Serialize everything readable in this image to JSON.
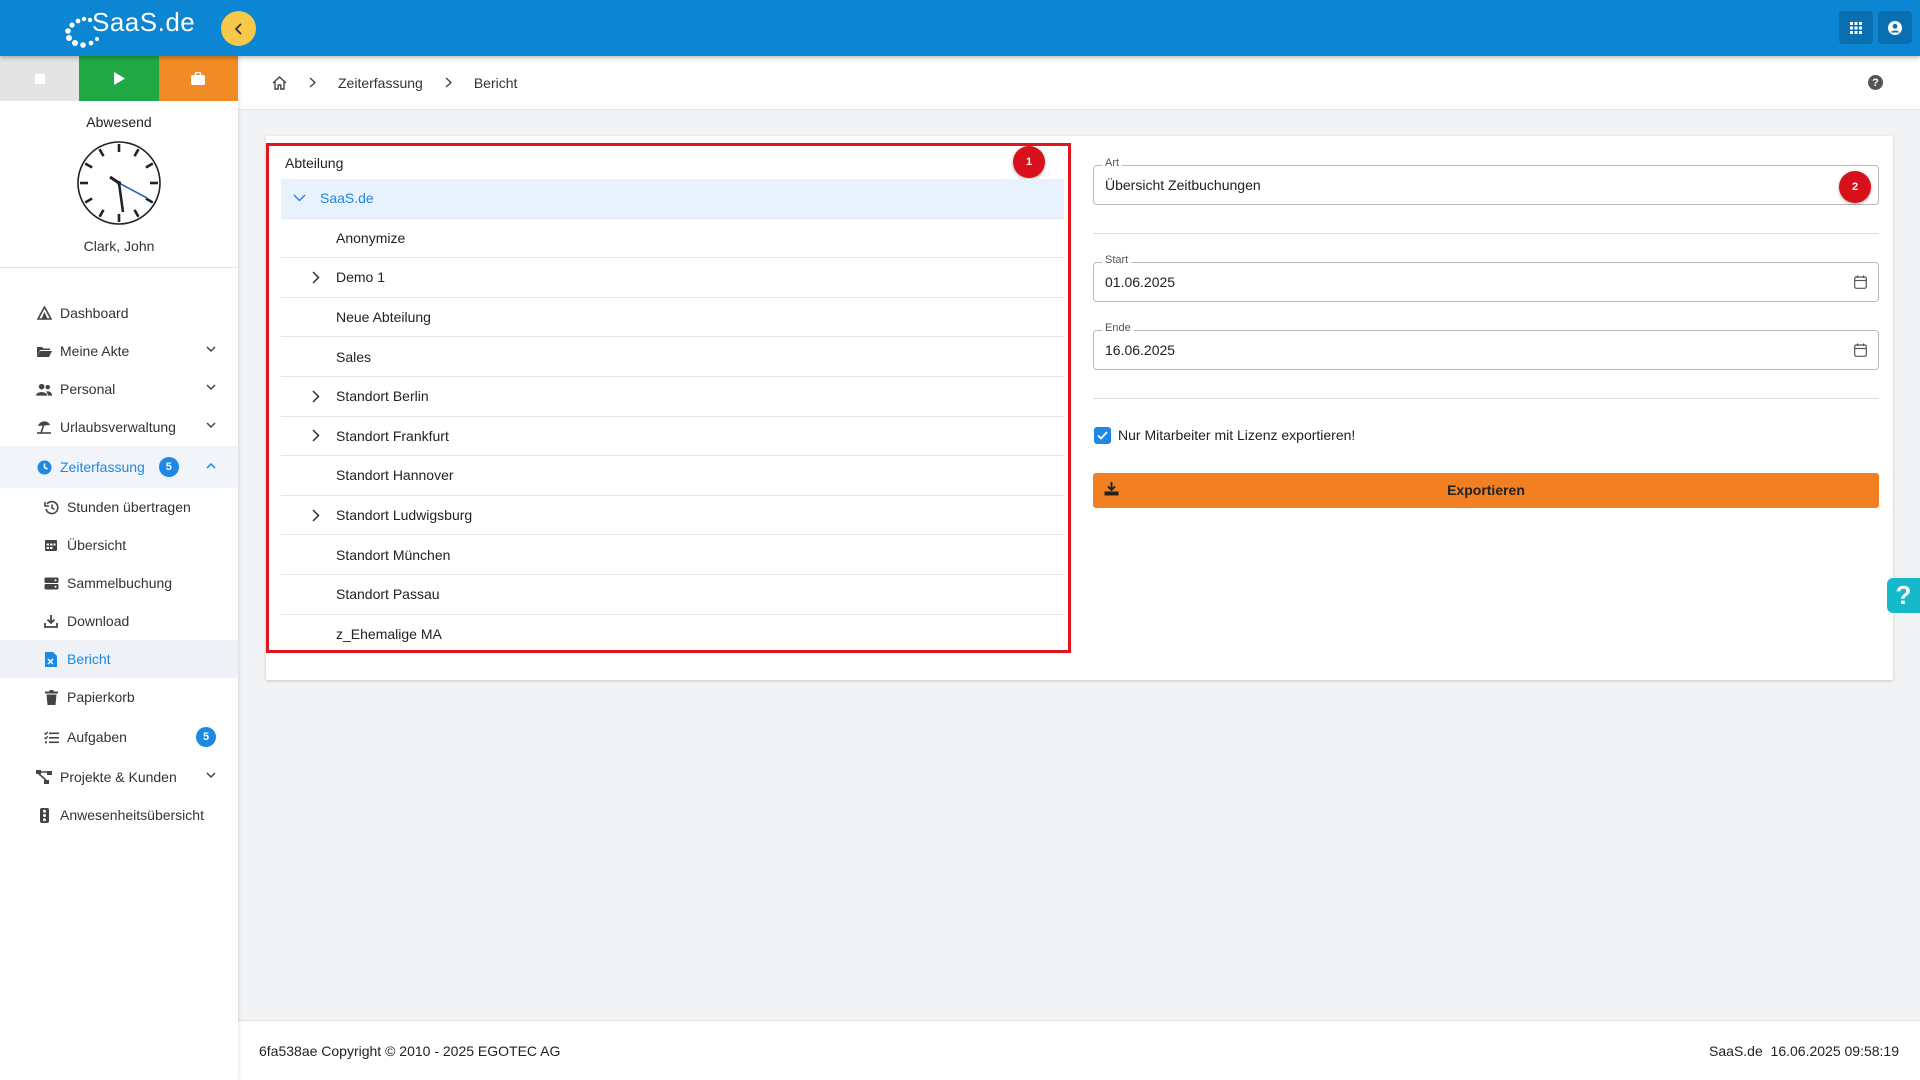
{
  "brand": {
    "logo_text": "SaaS.de"
  },
  "timer": {
    "status": "Abwesend",
    "user": "Clark, John"
  },
  "nav": {
    "dashboard": "Dashboard",
    "meine_akte": "Meine Akte",
    "personal": "Personal",
    "urlaubsverwaltung": "Urlaubsverwaltung",
    "zeiterfassung": "Zeiterfassung",
    "zeiterfassung_badge": "5",
    "stunden": "Stunden übertragen",
    "uebersicht": "Übersicht",
    "sammelbuchung": "Sammelbuchung",
    "download": "Download",
    "bericht": "Bericht",
    "papierkorb": "Papierkorb",
    "aufgaben": "Aufgaben",
    "aufgaben_badge": "5",
    "projekte": "Projekte & Kunden",
    "anwesenheit": "Anwesenheitsübersicht"
  },
  "breadcrumb": {
    "level1": "Zeiterfassung",
    "level2": "Bericht",
    "help": "?"
  },
  "tree": {
    "title": "Abteilung",
    "root": "SaaS.de",
    "items": [
      "Anonymize",
      "Demo 1",
      "Neue Abteilung",
      "Sales",
      "Standort Berlin",
      "Standort Frankfurt",
      "Standort Hannover",
      "Standort Ludwigsburg",
      "Standort München",
      "Standort Passau",
      "z_Ehemalige MA"
    ]
  },
  "markers": {
    "one": "1",
    "two": "2"
  },
  "form": {
    "art_label": "Art",
    "art_value": "Übersicht Zeitbuchungen",
    "start_label": "Start",
    "start_value": "01.06.2025",
    "ende_label": "Ende",
    "ende_value": "16.06.2025",
    "checkbox_label": "Nur Mitarbeiter mit Lizenz exportieren!",
    "export_label": "Exportieren"
  },
  "footer": {
    "copyright": "6fa538ae Copyright © 2010 - 2025 EGOTEC AG",
    "status": "SaaS.de  16.06.2025 09:58:19"
  },
  "colors": {
    "topbar": "#0c86d2",
    "accent": "#1e88e5",
    "export": "#f28023",
    "marker": "#d8101b",
    "play": "#1fa843"
  }
}
